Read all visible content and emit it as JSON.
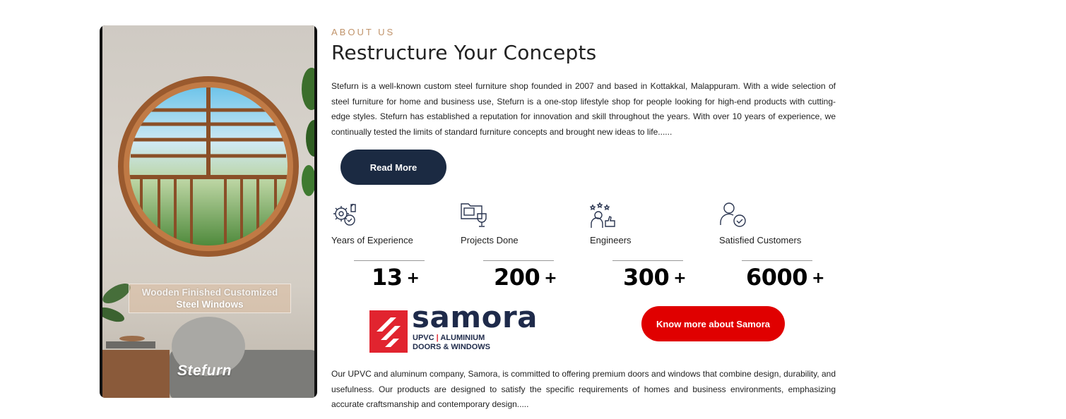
{
  "hero": {
    "caption_line1": "Wooden Finished Customized",
    "caption_line2": "Steel Windows",
    "brand": "Stefurn"
  },
  "about": {
    "eyebrow": "ABOUT US",
    "heading": "Restructure Your Concepts",
    "paragraph": "Stefurn is a well-known custom steel furniture shop founded in 2007 and based in Kottakkal, Malappuram. With a wide selection of steel furniture for home and business use, Stefurn is a one-stop lifestyle shop for people looking for high-end products with cutting-edge styles. Stefurn has established a reputation for innovation and skill throughout the years. With over 10 years of experience, we continually tested the limits of standard furniture concepts and brought new ideas to life......",
    "read_more_label": "Read More"
  },
  "stats": [
    {
      "label": "Years of Experience",
      "value": "13",
      "suffix": "+",
      "icon": "gear-thumbs-up-icon"
    },
    {
      "label": "Projects Done",
      "value": "200",
      "suffix": "+",
      "icon": "folder-trophy-icon"
    },
    {
      "label": "Engineers",
      "value": "300",
      "suffix": "+",
      "icon": "person-stars-thumbs-icon"
    },
    {
      "label": "Satisfied Customers",
      "value": "6000",
      "suffix": "+",
      "icon": "user-check-badge-icon"
    }
  ],
  "samora": {
    "logo_word": "samora",
    "logo_sub_1a": "UPVC",
    "logo_sub_1b": "ALUMINIUM",
    "logo_sub_2": "DOORS & WINDOWS",
    "button_label": "Know more about Samora",
    "paragraph": "Our UPVC and aluminum company, Samora, is committed to offering premium doors and windows that combine design, durability, and usefulness. Our products are designed to satisfy the specific requirements of homes and business environments, emphasizing accurate craftsmanship and contemporary design.....",
    "brand_red": "#e1242f",
    "brand_navy": "#1e2a4a"
  },
  "colors": {
    "accent_eyebrow": "#c0936a",
    "read_more_bg": "#1b2a42",
    "samora_button_bg": "#e00000"
  }
}
